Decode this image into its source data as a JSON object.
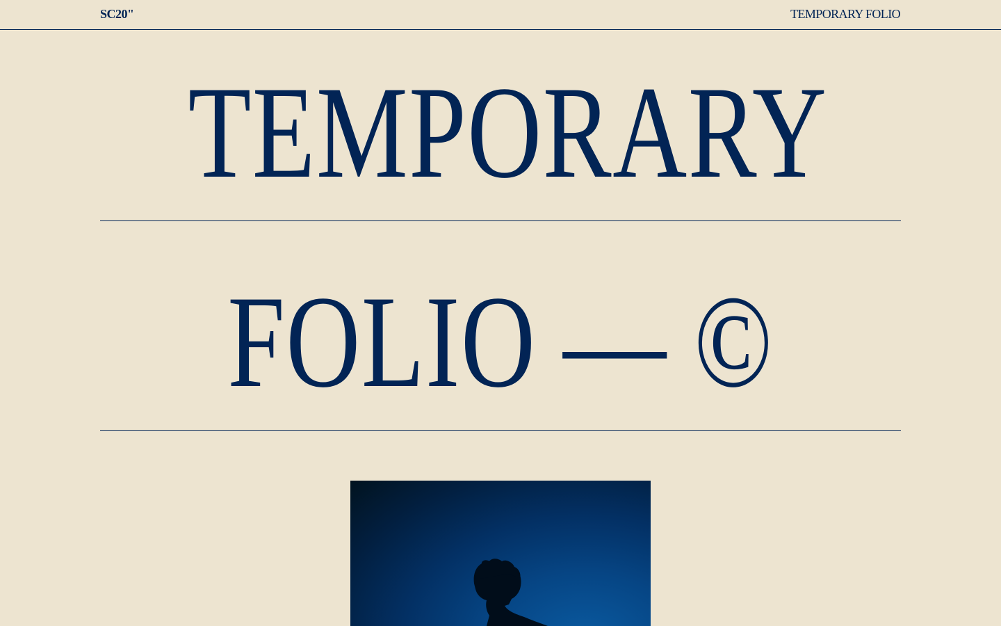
{
  "header": {
    "brand": "SC20\"",
    "title": "TEMPORARY FOLIO"
  },
  "hero": {
    "line1": "TEMPORARY",
    "line2": "FOLIO — ©"
  },
  "photo": {
    "subject": "silhouette-portrait"
  },
  "colors": {
    "background": "#ede4d0",
    "ink": "#022455"
  }
}
